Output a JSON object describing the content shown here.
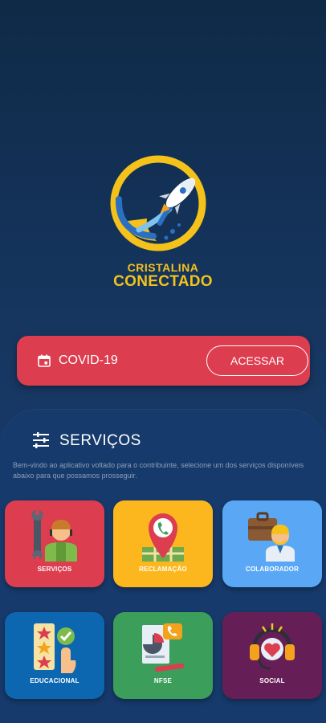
{
  "logo": {
    "line1": "CRISTALINA",
    "line2": "CONECTADO",
    "icon": "rocket-logo-icon"
  },
  "covid": {
    "icon": "calendar-icon",
    "label": "COVID-19",
    "button_label": "ACESSAR"
  },
  "services": {
    "icon": "sliders-icon",
    "title": "SERVIÇOS",
    "intro": "Bem-vindo ao aplicativo voltado para o contribuinte, selecione um dos serviços disponíveis abaixo para que possamos prosseguir."
  },
  "tiles": [
    {
      "label": "SERVIÇOS",
      "color": "#dc3d4f",
      "icon": "worker-wrench-icon"
    },
    {
      "label": "RECLAMAÇÃO",
      "color": "#fdb71e",
      "icon": "map-pin-phone-icon"
    },
    {
      "label": "COLABORADOR",
      "color": "#5aa8f5",
      "icon": "briefcase-person-icon"
    },
    {
      "label": "EDUCACIONAL",
      "color": "#0d67b0",
      "icon": "rating-checklist-icon"
    },
    {
      "label": "NFSE",
      "color": "#3c9e5b",
      "icon": "document-chart-icon"
    },
    {
      "label": "SOCIAL",
      "color": "#661f56",
      "icon": "headset-heart-icon"
    }
  ]
}
